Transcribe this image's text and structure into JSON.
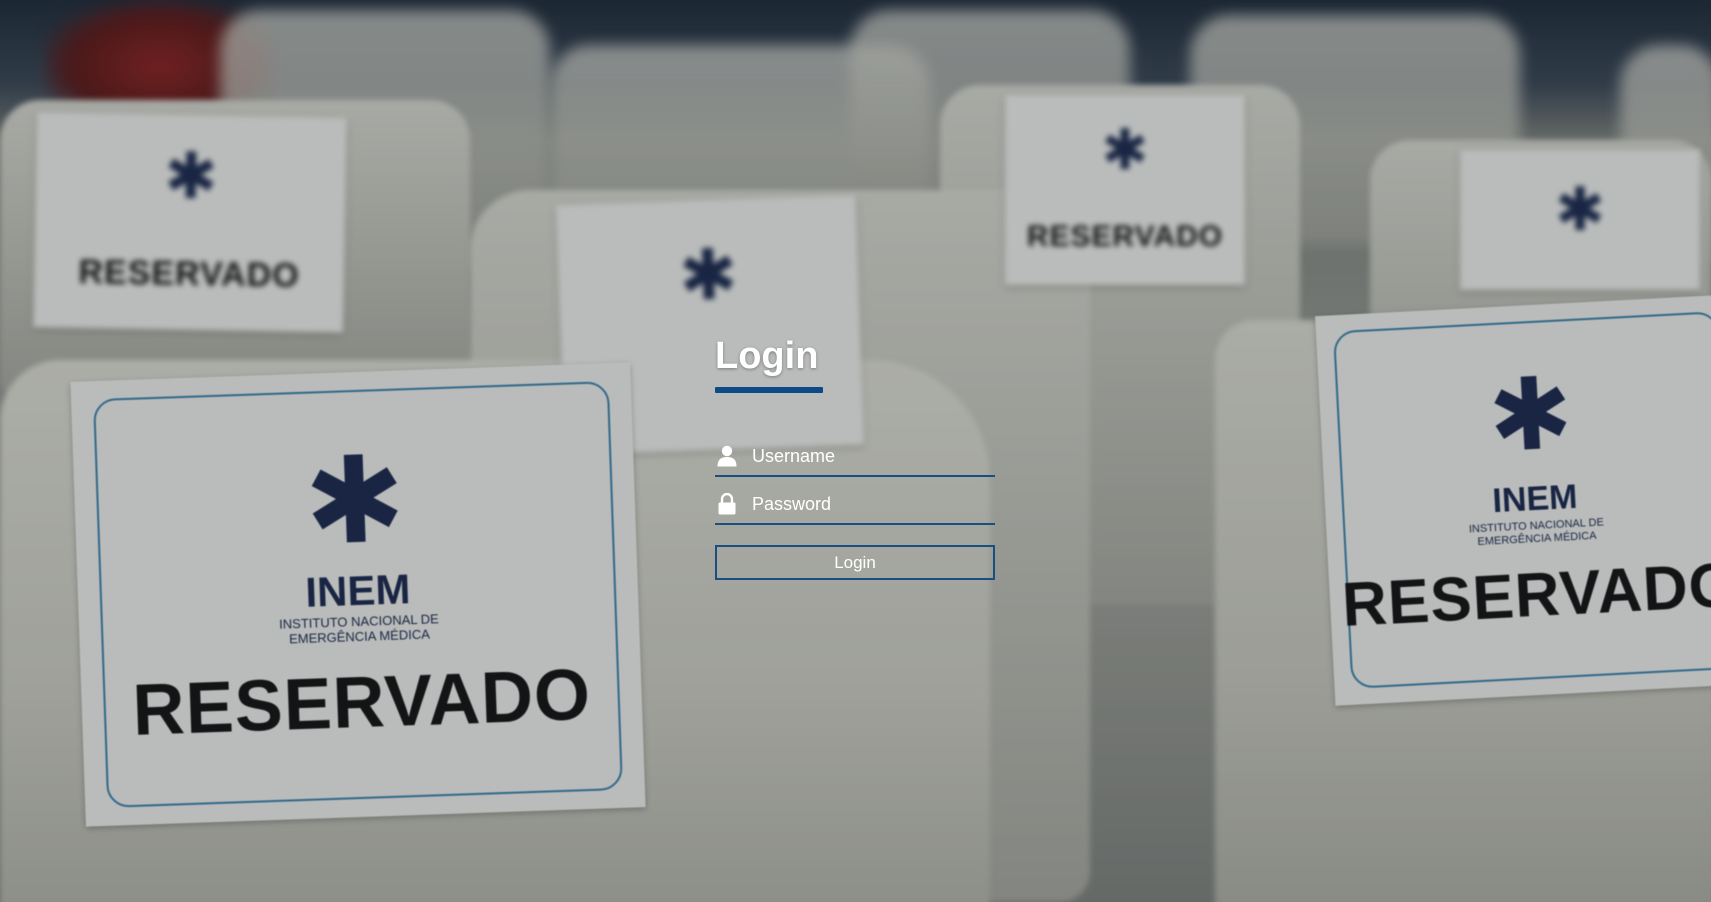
{
  "login": {
    "title": "Login",
    "username_placeholder": "Username",
    "password_placeholder": "Password",
    "button_label": "Login"
  },
  "icons": {
    "username": "user-icon",
    "password": "lock-icon"
  },
  "colors": {
    "accent": "#0e4b86",
    "field_border": "#1b4e80",
    "text": "#ffffff"
  },
  "background": {
    "sign_brand": "INEM",
    "sign_subtitle": "INSTITUTO NACIONAL DE EMERGÊNCIA MÉDICA",
    "sign_word": "RESERVADO"
  }
}
